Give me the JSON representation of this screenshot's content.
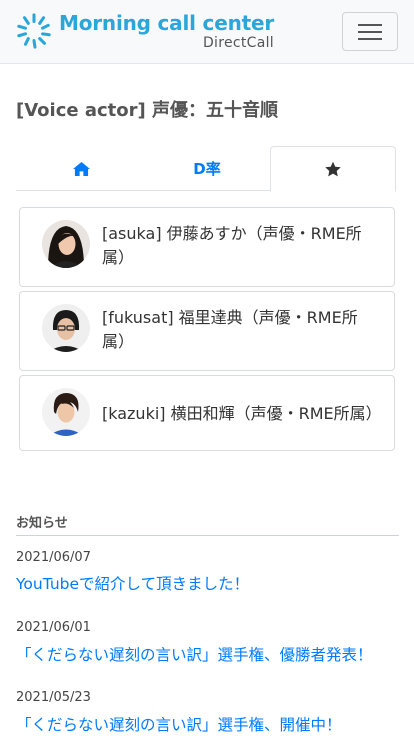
{
  "header": {
    "brand_title": "Morning call center",
    "brand_subtitle": "DirectCall",
    "menu_icon": "hamburger-icon",
    "brand_color": "#2aa7d8"
  },
  "page": {
    "title": "[Voice actor] 声優：五十音順"
  },
  "tabs": [
    {
      "icon": "home-icon",
      "label": ""
    },
    {
      "label": "D率"
    },
    {
      "icon": "star-icon",
      "label": "",
      "active": true
    }
  ],
  "actors": [
    {
      "label": "[asuka] 伊藤あすか（声優・RME所属）"
    },
    {
      "label": "[fukusat] 福里達典（声優・RME所属）"
    },
    {
      "label": "[kazuki] 横田和輝（声優・RME所属）"
    }
  ],
  "news": {
    "heading": "お知らせ",
    "items": [
      {
        "date": "2021/06/07",
        "title": "YouTubeで紹介して頂きました！"
      },
      {
        "date": "2021/06/01",
        "title": "「くだらない遅刻の言い訳」選手権、優勝者発表！"
      },
      {
        "date": "2021/05/23",
        "title": "「くだらない遅刻の言い訳」選手権、開催中！"
      }
    ]
  },
  "colors": {
    "link": "#007bff",
    "accent": "#2aa7d8"
  }
}
